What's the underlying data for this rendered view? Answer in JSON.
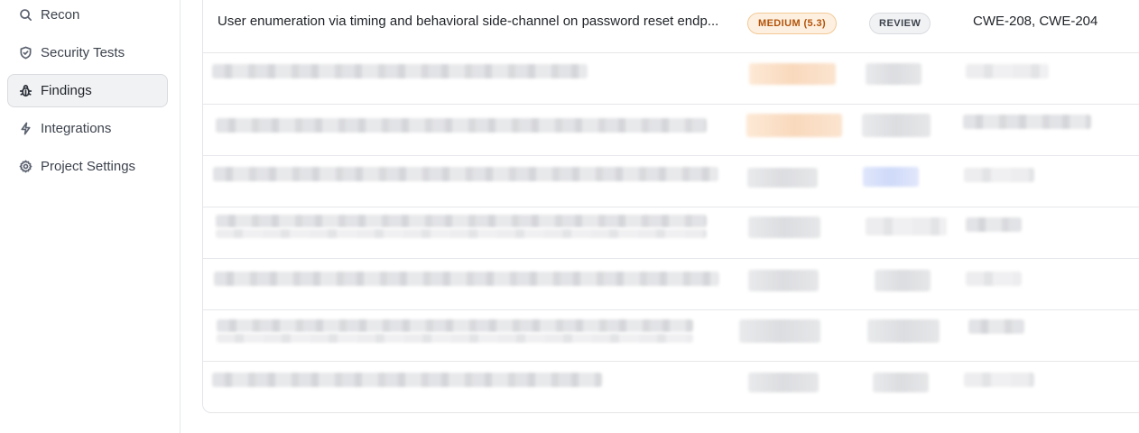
{
  "sidebar": {
    "items": [
      {
        "label": "Recon",
        "icon": "search-icon"
      },
      {
        "label": "Security Tests",
        "icon": "shield-icon"
      },
      {
        "label": "Findings",
        "icon": "bug-icon",
        "active": true
      },
      {
        "label": "Integrations",
        "icon": "lightning-icon"
      },
      {
        "label": "Project Settings",
        "icon": "gear-icon"
      }
    ]
  },
  "findings": {
    "rows": [
      {
        "title": "User enumeration via timing and behavioral side-channel on password reset endp...",
        "severity": "MEDIUM (5.3)",
        "status": "REVIEW",
        "cwe": "CWE-208, CWE-204"
      }
    ]
  },
  "colors": {
    "severity_medium_bg": "#fdf0e1",
    "severity_medium_text": "#b45309",
    "status_bg": "#f1f2f4",
    "active_nav_bg": "#f1f2f4"
  }
}
